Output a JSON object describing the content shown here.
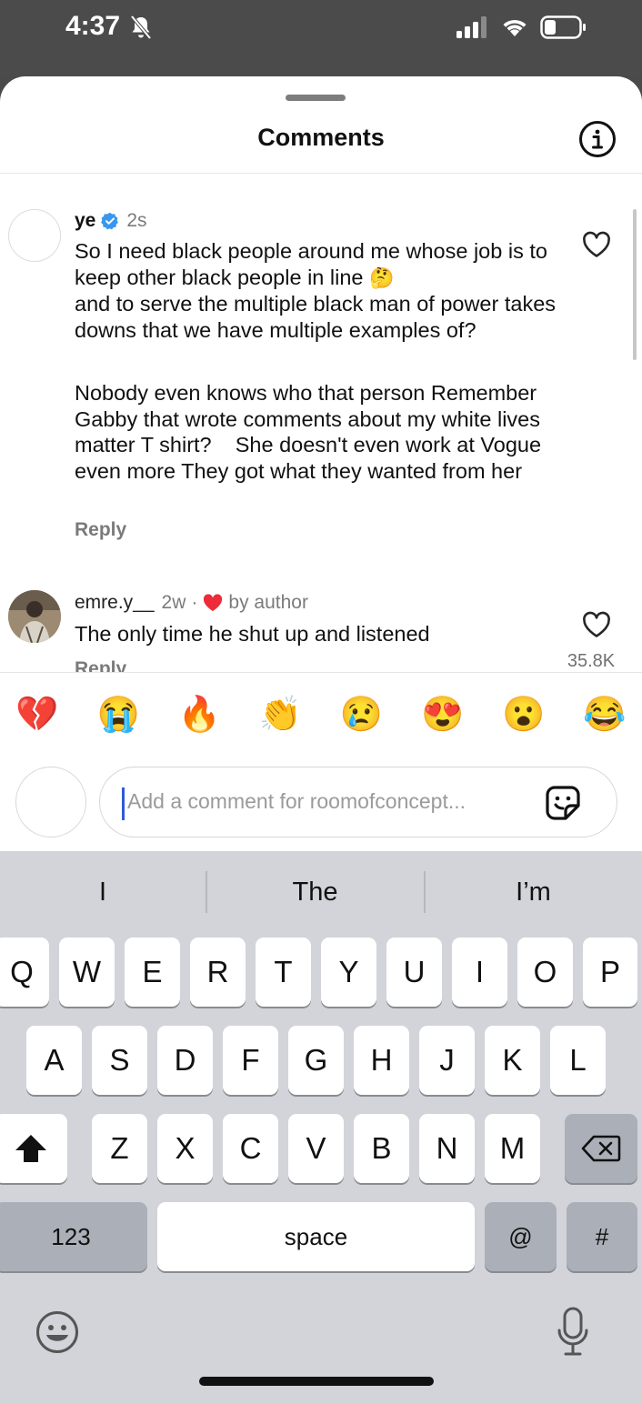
{
  "status_bar": {
    "time": "4:37"
  },
  "sheet": {
    "title": "Comments"
  },
  "comments": [
    {
      "username": "ye",
      "time": "2s",
      "text_p1": "So I need black people around me whose job is to keep other black people in line",
      "emoji_after_p1": "🤔",
      "text_p1b": "and to serve the multiple black man of power takes downs that we have multiple examples of?",
      "text_p2": "Nobody even knows who that person Remember Gabby that wrote comments about my white lives matter T shirt?    She doesn't even work at Vogue even more They got what they wanted from her",
      "reply_label": "Reply"
    },
    {
      "username": "emre.y__",
      "time": "2w",
      "separator": "·",
      "by_author": "by author",
      "text": "The only time he shut up and listened",
      "reply_label": "Reply",
      "likes": "35.8K"
    }
  ],
  "reactions": [
    "💔",
    "😭",
    "🔥",
    "👏",
    "😢",
    "😍",
    "😮",
    "😂"
  ],
  "comment_input": {
    "placeholder": "Add a comment for roomofconcept..."
  },
  "keyboard": {
    "predictions": [
      "I",
      "The",
      "I’m"
    ],
    "row1": [
      "Q",
      "W",
      "E",
      "R",
      "T",
      "Y",
      "U",
      "I",
      "O",
      "P"
    ],
    "row2": [
      "A",
      "S",
      "D",
      "F",
      "G",
      "H",
      "J",
      "K",
      "L"
    ],
    "row3": [
      "Z",
      "X",
      "C",
      "V",
      "B",
      "N",
      "M"
    ],
    "numbers_key": "123",
    "space_key": "space",
    "at_key": "@",
    "hash_key": "#"
  },
  "colors": {
    "accent_blue": "#3897f0",
    "heart_red": "#ed2b3a",
    "cursor": "#2d5bd8"
  },
  "icons": [
    "bell-slash-icon",
    "signal-icon",
    "wifi-icon",
    "battery-icon",
    "info-icon",
    "verified-icon",
    "heart-icon",
    "sticker-icon",
    "shift-icon",
    "delete-icon",
    "emoji-icon",
    "microphone-icon"
  ]
}
